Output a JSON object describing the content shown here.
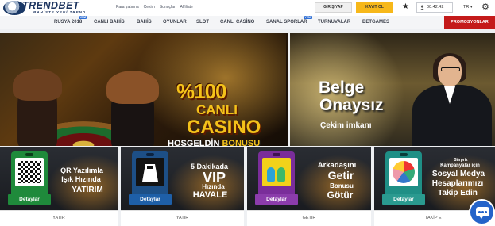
{
  "header": {
    "brand": "TRENDBET",
    "tagline": "BAHİSTE YENİ TREND",
    "links": [
      "Para yatırma",
      "Çekim",
      "Sonuçlar",
      "Affiliate"
    ],
    "login_label": "GİRİŞ YAP",
    "register_label": "KAYIT OL",
    "clock": "00:42:42",
    "language": "TR ▾",
    "colors": {
      "register": "#f7b81a",
      "promo": "#c41a1a"
    }
  },
  "nav": {
    "items": [
      {
        "label": "RUSYA 2018",
        "badge": "YENİ"
      },
      {
        "label": "CANLI BAHİS",
        "badge": ""
      },
      {
        "label": "BAHİS",
        "badge": ""
      },
      {
        "label": "OYUNLAR",
        "badge": ""
      },
      {
        "label": "SLOT",
        "badge": ""
      },
      {
        "label": "CANLI CASİNO",
        "badge": ""
      },
      {
        "label": "SANAL SPORLAR",
        "badge": "YENİ"
      },
      {
        "label": "TURNUVALAR",
        "badge": ""
      },
      {
        "label": "BETGAMES",
        "badge": ""
      }
    ],
    "promotions_label": "PROMOSYONLAR"
  },
  "hero": {
    "left": {
      "line1": "%100",
      "line2": "CANLI",
      "line3": "CASINO",
      "line4_a": "HOŞGELDİN",
      "line4_b": "BONUSU"
    },
    "right": {
      "line1": "Belge",
      "line2": "Onaysız",
      "line3": "Çekim imkanı"
    }
  },
  "cards": [
    {
      "lines": [
        "QR Yazılımla",
        "Işık Hızında",
        "YATIRIM"
      ],
      "button": "Detaylar",
      "footer": "YATIR"
    },
    {
      "lines": [
        "5 Dakikada",
        "VIP",
        "Hızında",
        "HAVALE"
      ],
      "button": "Detaylar",
      "footer": "YATIR"
    },
    {
      "lines": [
        "Arkadaşını",
        "Getir",
        "Bonusu",
        "Götür"
      ],
      "button": "Detaylar",
      "footer": "GETIR"
    },
    {
      "lines": [
        "Sürpriz",
        "Kampanyalar için",
        "Sosyal Medya",
        "Hesaplarımızı",
        "Takip Edin"
      ],
      "button": "Detaylar",
      "footer": "TAKİP ET"
    }
  ]
}
